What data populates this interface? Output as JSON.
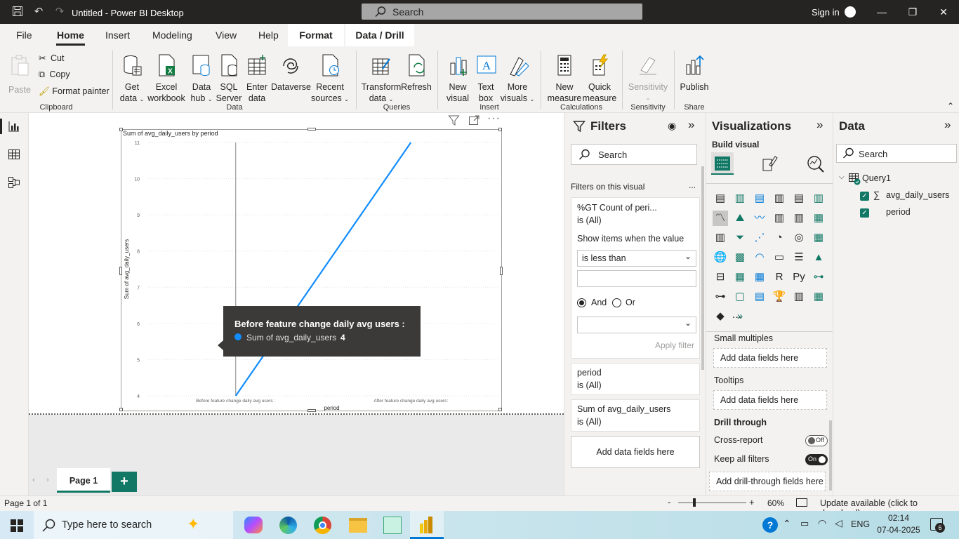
{
  "titlebar": {
    "title": "Untitled - Power BI Desktop",
    "search_placeholder": "Search",
    "signin": "Sign in"
  },
  "tabs": [
    "File",
    "Home",
    "Insert",
    "Modeling",
    "View",
    "Help",
    "Format",
    "Data / Drill"
  ],
  "ribbon": {
    "clipboard": {
      "paste": "Paste",
      "cut": "Cut",
      "copy": "Copy",
      "format_painter": "Format painter",
      "group": "Clipboard"
    },
    "data": {
      "get_data": [
        "Get",
        "data"
      ],
      "excel": [
        "Excel",
        "workbook"
      ],
      "data_hub": [
        "Data",
        "hub"
      ],
      "sql": [
        "SQL",
        "Server"
      ],
      "enter": [
        "Enter",
        "data"
      ],
      "dataverse": "Dataverse",
      "recent": [
        "Recent",
        "sources"
      ],
      "group": "Data"
    },
    "queries": {
      "transform": [
        "Transform",
        "data"
      ],
      "refresh": "Refresh",
      "group": "Queries"
    },
    "insert": {
      "new_visual": [
        "New",
        "visual"
      ],
      "text_box": [
        "Text",
        "box"
      ],
      "more_visuals": [
        "More",
        "visuals"
      ],
      "group": "Insert"
    },
    "calculations": {
      "new_measure": [
        "New",
        "measure"
      ],
      "quick_measure": [
        "Quick",
        "measure"
      ],
      "group": "Calculations"
    },
    "sensitivity": {
      "label": "Sensitivity",
      "group": "Sensitivity"
    },
    "share": {
      "publish": "Publish",
      "group": "Share"
    }
  },
  "visual": {
    "title": "Sum of avg_daily_users by period",
    "chart_data": {
      "type": "line",
      "title": "Sum of avg_daily_users by period",
      "xlabel": "period",
      "ylabel": "Sum of avg_daily_users",
      "categories": [
        "Before feature change daily avg users :",
        "After feature change daily avg users:"
      ],
      "series": [
        {
          "name": "Sum of avg_daily_users",
          "values": [
            4,
            11
          ]
        }
      ],
      "yticks": [
        "4",
        "5",
        "6",
        "7",
        "8",
        "9",
        "10",
        "11"
      ],
      "ylim": [
        4,
        11
      ],
      "grid": true,
      "color": "#118dff"
    },
    "tooltip": {
      "title": "Before feature change daily avg users :",
      "series_label": "Sum of avg_daily_users",
      "value": "4"
    }
  },
  "filters": {
    "header": "Filters",
    "search": "Search",
    "section": "Filters on this visual",
    "more": "...",
    "card1": {
      "title": "%GT Count of peri...",
      "state": "is (All)",
      "show_items": "Show items when the value",
      "condition": "is less than",
      "and": "And",
      "or": "Or",
      "apply": "Apply filter"
    },
    "card2": {
      "title": "period",
      "state": "is (All)"
    },
    "card3": {
      "title": "Sum of avg_daily_users",
      "state": "is (All)"
    },
    "add_fields": "Add data fields here"
  },
  "visualizations": {
    "header": "Visualizations",
    "build": "Build visual",
    "small_multiples": "Small multiples",
    "tooltips": "Tooltips",
    "drill_through": "Drill through",
    "cross_report": "Cross-report",
    "cross_report_state": "Off",
    "keep_filters": "Keep all filters",
    "keep_filters_state": "On",
    "add_fields": "Add data fields here",
    "add_drill": "Add drill-through fields here",
    "more": "..."
  },
  "data_pane": {
    "header": "Data",
    "search": "Search",
    "table": "Query1",
    "fields": [
      "avg_daily_users",
      "period"
    ]
  },
  "page": {
    "tab": "Page 1",
    "add": "+"
  },
  "status": {
    "page_info": "Page 1 of 1",
    "zoom": "60%",
    "update": "Update available (click to download)"
  },
  "taskbar": {
    "search": "Type here to search",
    "lang": "ENG",
    "time": "02:14",
    "date": "07-04-2025",
    "notif": "6"
  }
}
